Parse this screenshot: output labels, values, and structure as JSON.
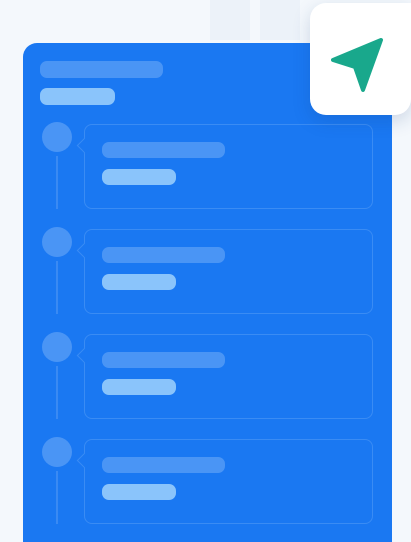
{
  "timeline": {
    "items": [
      {
        "id": 1
      },
      {
        "id": 2
      },
      {
        "id": 3
      },
      {
        "id": 4
      }
    ]
  },
  "badge": {
    "icon": "navigation-arrow-icon",
    "icon_color": "#19a88c"
  },
  "colors": {
    "card": "#1a78f2",
    "placeholder_dark": "#4a95f5",
    "placeholder_light": "#8ac4fb",
    "background": "#f4f8fc"
  }
}
